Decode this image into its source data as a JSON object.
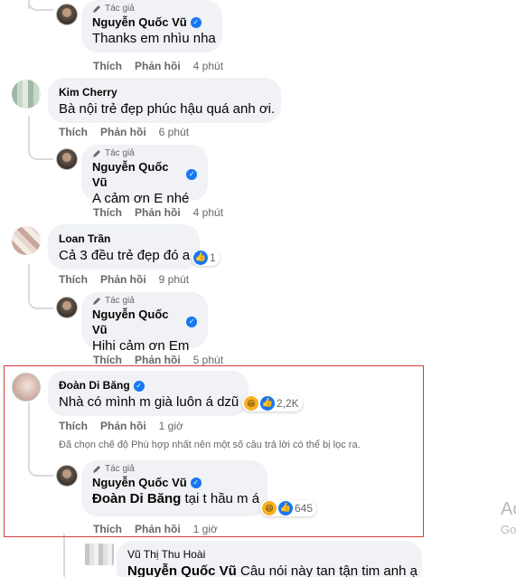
{
  "author_label": "Tác giả",
  "actions": {
    "like": "Thích",
    "reply": "Phản hồi"
  },
  "comments": [
    {
      "name": "Nguyễn Quốc Vũ",
      "text": "Thanks em nhìu nha",
      "time": "4 phút"
    },
    {
      "name": "Kim Cherry",
      "text": "Bà nội trẻ đẹp phúc hậu quá anh ơi.",
      "time": "6 phút"
    },
    {
      "name": "Nguyễn Quốc Vũ",
      "text": "A cảm ơn E nhé",
      "time": "4 phút"
    },
    {
      "name": "Loan Trần",
      "text": "Cả 3 đều trẻ đẹp đó a",
      "time": "9 phút",
      "reactions": "1"
    },
    {
      "name": "Nguyễn Quốc Vũ",
      "text": "Hihi cảm ơn Em",
      "time": "5 phút"
    },
    {
      "name": "Đoàn Di Băng",
      "text": "Nhà có mình m già luôn á dzũ",
      "time": "1 giờ",
      "reactions": "2,2K"
    },
    {
      "name": "Nguyễn Quốc Vũ",
      "tag": "Đoàn Di Băng",
      "text": " tại t hầu m á",
      "time": "1 giờ",
      "reactions": "645"
    },
    {
      "name": "Vũ Thị Thu Hoài",
      "tag": "Nguyễn Quốc Vũ",
      "text": " Câu nói này tan tận tim anh ạ"
    }
  ],
  "filter_note": "Đã chọn chế độ Phù hợp nhất nên một số câu trả lời có thể bị lọc ra.",
  "watermark": {
    "line1": "Ac",
    "line2": "Go"
  },
  "colors": {
    "verified": "#1877f2",
    "highlight_border": "#d93a3a",
    "bubble": "#f0f2f5"
  }
}
